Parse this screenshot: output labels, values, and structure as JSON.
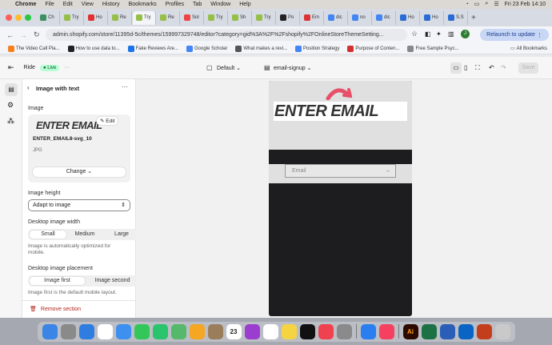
{
  "menubar": {
    "apple": "",
    "app": "Chrome",
    "items": [
      "File",
      "Edit",
      "View",
      "History",
      "Bookmarks",
      "Profiles",
      "Tab",
      "Window",
      "Help"
    ],
    "datetime": "Fri 23 Feb  14:10"
  },
  "tabs": [
    "Ch",
    "Try",
    "Ho",
    "Re",
    "Try",
    "Re",
    "Sol",
    "Try",
    "Sh",
    "Try",
    "Po",
    "Em",
    "dic",
    "no",
    "dic",
    "Ho",
    "Ho",
    "S.S"
  ],
  "tab_colors": [
    "#3c8f5f",
    "#95bf47",
    "#e03131",
    "#95bf47",
    "#95bf47",
    "#95bf47",
    "#e44",
    "#95bf47",
    "#95bf47",
    "#95bf47",
    "#222",
    "#d33",
    "#4285f4",
    "#4285f4",
    "#4285f4",
    "#2b6cd4",
    "#2b6cd4",
    "#2b6cd4"
  ],
  "address": {
    "url": "admin.shopify.com/store/11395d-5c/themes/159997329748/editor?category=gid%3A%2F%2Fshopify%2FOnlineStoreThemeSetting...",
    "relaunch": "Relaunch to update"
  },
  "bookmarks": [
    "The Video Call Pla...",
    "How to use data to...",
    "Fake Reviews Are...",
    "Google Scholar",
    "What makes a revi...",
    "Position Strategy",
    "Purpose of Conten...",
    "Free Sample Psyc..."
  ],
  "all_bookmarks": "All Bookmarks",
  "shop": {
    "store": "Ride",
    "status": "Live",
    "theme": "Default",
    "template": "email-signup",
    "save": "Save"
  },
  "panel": {
    "title": "Image with text",
    "image_label": "Image",
    "edit": "Edit",
    "image_text": "ENTER EMAIL",
    "filename": "ENTER_EMAIL8-svg_10",
    "filetype": "JPG",
    "change": "Change",
    "height_label": "Image height",
    "height_value": "Adapt to image",
    "width_label": "Desktop image width",
    "width_options": [
      "Small",
      "Medium",
      "Large"
    ],
    "width_hint": "Image is automatically optimized for mobile.",
    "placement_label": "Desktop image placement",
    "placement_options": [
      "Image first",
      "Image second"
    ],
    "placement_hint": "Image first is the default mobile layout.",
    "remove": "Remove section"
  },
  "preview": {
    "heading": "ENTER EMAIL",
    "email_placeholder": "Email",
    "submit": "→"
  },
  "dock": [
    "Finder",
    "Launchpad",
    "Safari",
    "Chrome",
    "Mail",
    "Messages",
    "WhatsApp",
    "Maps",
    "Photos",
    "Contacts",
    "Calendar",
    "Podcasts",
    "Reminders",
    "Notes",
    "TV",
    "News",
    "Settings",
    "App Store",
    "Music",
    "Illustrator",
    "Excel",
    "Word",
    "Outlook",
    "PowerPoint",
    "Trash"
  ],
  "dock_colors": [
    "#3a85e6",
    "#8a8a8a",
    "#2f7de1",
    "#ffffff",
    "#3d8ff0",
    "#33c759",
    "#29c46b",
    "#55b86a",
    "#f5a623",
    "#9a7d5b",
    "#ffffff",
    "#9b3ecf",
    "#ffffff",
    "#f5d442",
    "#111111",
    "#f0414f",
    "#8a8a8a",
    "#2a7ef0",
    "#f5415f",
    "#2d0a00",
    "#1e7145",
    "#2b5fb7",
    "#0a64c4",
    "#c43e1c",
    "#c9c9c9"
  ],
  "dock_badges": {
    "5": "",
    "6": "",
    "8": "",
    "10": "23"
  }
}
